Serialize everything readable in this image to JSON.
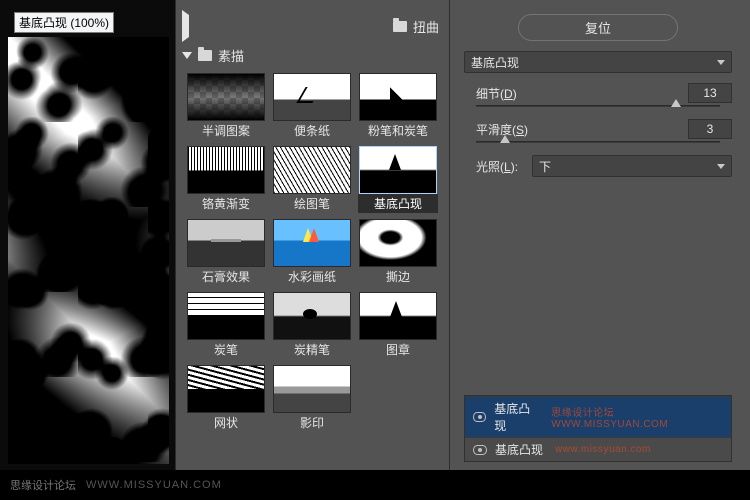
{
  "preview": {
    "title": "基底凸现 (100%)"
  },
  "tree": {
    "collapsed": {
      "label": "扭曲"
    },
    "expanded": {
      "label": "素描"
    }
  },
  "filters": [
    {
      "label": "半调图案",
      "t": "t0"
    },
    {
      "label": "便条纸",
      "t": "t1"
    },
    {
      "label": "粉笔和炭笔",
      "t": "t2"
    },
    {
      "label": "铬黄渐变",
      "t": "t3"
    },
    {
      "label": "绘图笔",
      "t": "t4"
    },
    {
      "label": "基底凸现",
      "t": "t5",
      "selected": true
    },
    {
      "label": "石膏效果",
      "t": "t6"
    },
    {
      "label": "水彩画纸",
      "t": "t7"
    },
    {
      "label": "撕边",
      "t": "t8"
    },
    {
      "label": "炭笔",
      "t": "t9"
    },
    {
      "label": "炭精笔",
      "t": "t10"
    },
    {
      "label": "图章",
      "t": "t11"
    },
    {
      "label": "网状",
      "t": "t12"
    },
    {
      "label": "影印",
      "t": "t13"
    }
  ],
  "controls": {
    "reset": "复位",
    "filterSelect": "基底凸现",
    "detail": {
      "label": "细节",
      "hotkey": "D",
      "value": "13",
      "pct": 82
    },
    "smoothness": {
      "label": "平滑度",
      "hotkey": "S",
      "value": "3",
      "pct": 12
    },
    "light": {
      "label": "光照",
      "hotkey": "L",
      "value": "下"
    }
  },
  "layers": [
    {
      "label": "基底凸现",
      "selected": true,
      "wm": "思缘设计论坛 WWW.MISSYUAN.COM"
    },
    {
      "label": "基底凸现",
      "wm": "www.missyuan.com"
    }
  ],
  "footer": {
    "forum": "思缘设计论坛",
    "site": "WWW.MISSYUAN.COM"
  }
}
